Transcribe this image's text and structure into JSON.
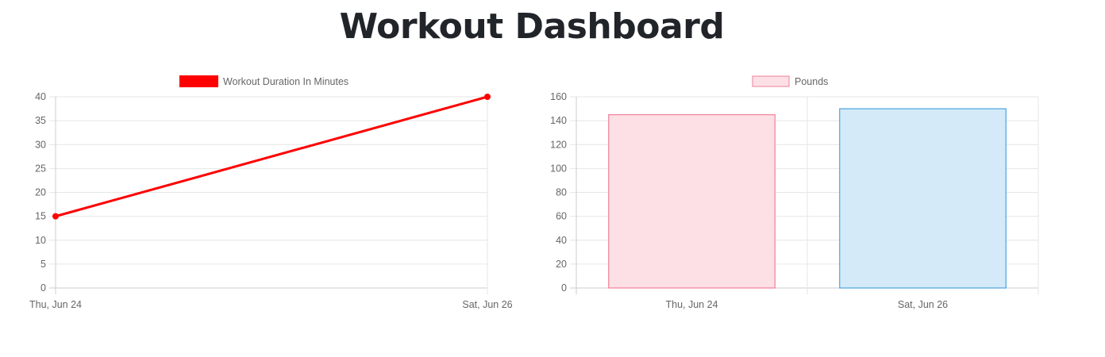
{
  "page": {
    "title": "Workout Dashboard"
  },
  "colors": {
    "line": "#ff0000",
    "bar_pink_fill": "#fde0e6",
    "bar_pink_border": "#f08098",
    "bar_blue_fill": "#d4eaf8",
    "bar_blue_border": "#4aa3df",
    "grid": "#e6e6e6",
    "text": "#666666"
  },
  "chart_data": [
    {
      "type": "line",
      "title": "",
      "legend": "Workout Duration In Minutes",
      "x": [
        "Thu, Jun 24",
        "Sat, Jun 26"
      ],
      "series": [
        {
          "name": "Workout Duration In Minutes",
          "values": [
            15,
            40
          ]
        }
      ],
      "ylim": [
        0,
        40
      ],
      "yticks": [
        0,
        5,
        10,
        15,
        20,
        25,
        30,
        35,
        40
      ],
      "xlabel": "",
      "ylabel": "",
      "grid": true,
      "legend_position": "top"
    },
    {
      "type": "bar",
      "title": "",
      "legend": "Pounds",
      "categories": [
        "Thu, Jun 24",
        "Sat, Jun 26"
      ],
      "series": [
        {
          "name": "Pounds",
          "values": [
            145,
            150
          ]
        }
      ],
      "ylim": [
        0,
        160
      ],
      "yticks": [
        0,
        20,
        40,
        60,
        80,
        100,
        120,
        140,
        160
      ],
      "xlabel": "",
      "ylabel": "",
      "grid": true,
      "legend_position": "top"
    }
  ]
}
